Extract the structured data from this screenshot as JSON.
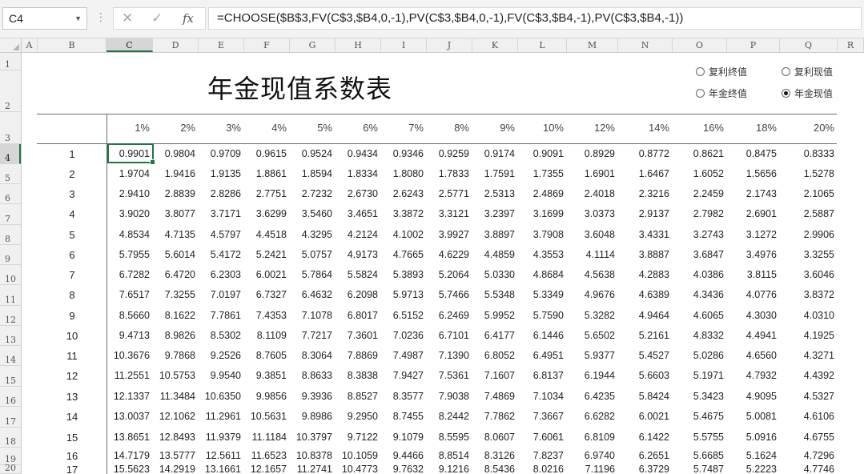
{
  "formula_bar": {
    "name_box": "C4",
    "formula": "=CHOOSE($B$3,FV(C$3,$B4,0,-1),PV(C$3,$B4,0,-1),FV(C$3,$B4,-1),PV(C$3,$B4,-1))",
    "fx_label": "fx"
  },
  "columns": [
    "A",
    "B",
    "C",
    "D",
    "E",
    "F",
    "G",
    "H",
    "I",
    "J",
    "K",
    "L",
    "M",
    "N",
    "O",
    "P",
    "Q",
    "R"
  ],
  "row_numbers": [
    "1",
    "2",
    "3",
    "4",
    "5",
    "6",
    "7",
    "8",
    "9",
    "10",
    "11",
    "12",
    "13",
    "14",
    "15",
    "16",
    "17",
    "18",
    "19",
    "20"
  ],
  "sheet": {
    "title": "年金现值系数表",
    "options": [
      {
        "label": "复利终值",
        "selected": false
      },
      {
        "label": "复利现值",
        "selected": false
      },
      {
        "label": "年金终值",
        "selected": false
      },
      {
        "label": "年金现值",
        "selected": true
      }
    ],
    "rates": [
      "1%",
      "2%",
      "3%",
      "4%",
      "5%",
      "6%",
      "7%",
      "8%",
      "9%",
      "10%",
      "12%",
      "14%",
      "16%",
      "18%",
      "20%"
    ],
    "periods": [
      "1",
      "2",
      "3",
      "4",
      "5",
      "6",
      "7",
      "8",
      "9",
      "10",
      "11",
      "12",
      "13",
      "14",
      "15",
      "16",
      "17"
    ],
    "table": [
      [
        "0.9901",
        "0.9804",
        "0.9709",
        "0.9615",
        "0.9524",
        "0.9434",
        "0.9346",
        "0.9259",
        "0.9174",
        "0.9091",
        "0.8929",
        "0.8772",
        "0.8621",
        "0.8475",
        "0.8333"
      ],
      [
        "1.9704",
        "1.9416",
        "1.9135",
        "1.8861",
        "1.8594",
        "1.8334",
        "1.8080",
        "1.7833",
        "1.7591",
        "1.7355",
        "1.6901",
        "1.6467",
        "1.6052",
        "1.5656",
        "1.5278"
      ],
      [
        "2.9410",
        "2.8839",
        "2.8286",
        "2.7751",
        "2.7232",
        "2.6730",
        "2.6243",
        "2.5771",
        "2.5313",
        "2.4869",
        "2.4018",
        "2.3216",
        "2.2459",
        "2.1743",
        "2.1065"
      ],
      [
        "3.9020",
        "3.8077",
        "3.7171",
        "3.6299",
        "3.5460",
        "3.4651",
        "3.3872",
        "3.3121",
        "3.2397",
        "3.1699",
        "3.0373",
        "2.9137",
        "2.7982",
        "2.6901",
        "2.5887"
      ],
      [
        "4.8534",
        "4.7135",
        "4.5797",
        "4.4518",
        "4.3295",
        "4.2124",
        "4.1002",
        "3.9927",
        "3.8897",
        "3.7908",
        "3.6048",
        "3.4331",
        "3.2743",
        "3.1272",
        "2.9906"
      ],
      [
        "5.7955",
        "5.6014",
        "5.4172",
        "5.2421",
        "5.0757",
        "4.9173",
        "4.7665",
        "4.6229",
        "4.4859",
        "4.3553",
        "4.1114",
        "3.8887",
        "3.6847",
        "3.4976",
        "3.3255"
      ],
      [
        "6.7282",
        "6.4720",
        "6.2303",
        "6.0021",
        "5.7864",
        "5.5824",
        "5.3893",
        "5.2064",
        "5.0330",
        "4.8684",
        "4.5638",
        "4.2883",
        "4.0386",
        "3.8115",
        "3.6046"
      ],
      [
        "7.6517",
        "7.3255",
        "7.0197",
        "6.7327",
        "6.4632",
        "6.2098",
        "5.9713",
        "5.7466",
        "5.5348",
        "5.3349",
        "4.9676",
        "4.6389",
        "4.3436",
        "4.0776",
        "3.8372"
      ],
      [
        "8.5660",
        "8.1622",
        "7.7861",
        "7.4353",
        "7.1078",
        "6.8017",
        "6.5152",
        "6.2469",
        "5.9952",
        "5.7590",
        "5.3282",
        "4.9464",
        "4.6065",
        "4.3030",
        "4.0310"
      ],
      [
        "9.4713",
        "8.9826",
        "8.5302",
        "8.1109",
        "7.7217",
        "7.3601",
        "7.0236",
        "6.7101",
        "6.4177",
        "6.1446",
        "5.6502",
        "5.2161",
        "4.8332",
        "4.4941",
        "4.1925"
      ],
      [
        "10.3676",
        "9.7868",
        "9.2526",
        "8.7605",
        "8.3064",
        "7.8869",
        "7.4987",
        "7.1390",
        "6.8052",
        "6.4951",
        "5.9377",
        "5.4527",
        "5.0286",
        "4.6560",
        "4.3271"
      ],
      [
        "11.2551",
        "10.5753",
        "9.9540",
        "9.3851",
        "8.8633",
        "8.3838",
        "7.9427",
        "7.5361",
        "7.1607",
        "6.8137",
        "6.1944",
        "5.6603",
        "5.1971",
        "4.7932",
        "4.4392"
      ],
      [
        "12.1337",
        "11.3484",
        "10.6350",
        "9.9856",
        "9.3936",
        "8.8527",
        "8.3577",
        "7.9038",
        "7.4869",
        "7.1034",
        "6.4235",
        "5.8424",
        "5.3423",
        "4.9095",
        "4.5327"
      ],
      [
        "13.0037",
        "12.1062",
        "11.2961",
        "10.5631",
        "9.8986",
        "9.2950",
        "8.7455",
        "8.2442",
        "7.7862",
        "7.3667",
        "6.6282",
        "6.0021",
        "5.4675",
        "5.0081",
        "4.6106"
      ],
      [
        "13.8651",
        "12.8493",
        "11.9379",
        "11.1184",
        "10.3797",
        "9.7122",
        "9.1079",
        "8.5595",
        "8.0607",
        "7.6061",
        "6.8109",
        "6.1422",
        "5.5755",
        "5.0916",
        "4.6755"
      ],
      [
        "14.7179",
        "13.5777",
        "12.5611",
        "11.6523",
        "10.8378",
        "10.1059",
        "9.4466",
        "8.8514",
        "8.3126",
        "7.8237",
        "6.9740",
        "6.2651",
        "5.6685",
        "5.1624",
        "4.7296"
      ],
      [
        "15.5623",
        "14.2919",
        "13.1661",
        "12.1657",
        "11.2741",
        "10.4773",
        "9.7632",
        "9.1216",
        "8.5436",
        "8.0216",
        "7.1196",
        "6.3729",
        "5.7487",
        "5.2223",
        "4.7746"
      ]
    ]
  }
}
